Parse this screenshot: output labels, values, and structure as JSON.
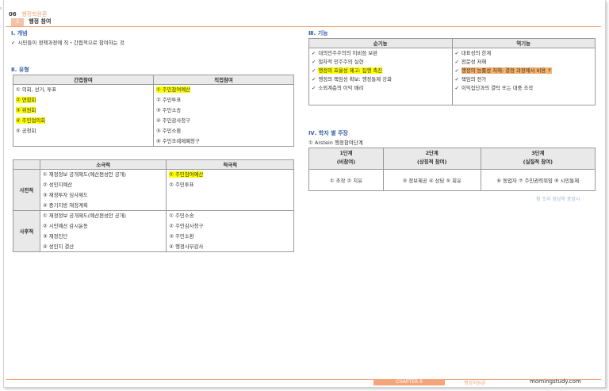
{
  "header": {
    "chapter_num": "06",
    "category": "행정학원론",
    "section_num": "1",
    "section_title": "행정 참여"
  },
  "s1": {
    "heading": "Ⅰ. 개념",
    "text": "시민들이 정책과정에 직・간접적으로 참여하는 것"
  },
  "s2": {
    "heading": "Ⅱ. 유형",
    "table1": {
      "headers": [
        "간접참여",
        "직접참여"
      ],
      "left": [
        "① 의회, 선거, 투표",
        "② 연합회",
        "③ 위원회",
        "④ 주민협의회",
        "⑤ 공청회",
        ""
      ],
      "right": [
        "① 주민참여예산",
        "② 주민투표",
        "③ 주민소송",
        "④ 주민감사청구",
        "⑤ 주민소환",
        "⑥ 주민조례제폐청구"
      ]
    },
    "table2": {
      "headers": [
        "",
        "소극적",
        "적극적"
      ],
      "pre_label": "사전적",
      "pre_left": [
        "① 재정정보 공개제도(예산편성안 공개)",
        "② 성인지예산",
        "③ 재정투자 심사제도",
        "④ 중기지방 재정계획"
      ],
      "pre_right": [
        "① 주민참여예산",
        "② 주민투표",
        "",
        ""
      ],
      "post_label": "사후적",
      "post_left": [
        "① 재정정보 공개제도(예산편성안 공개)",
        "② 시민예산 감시운동",
        "③ 재정진단",
        "④ 성인지 결산"
      ],
      "post_right": [
        "① 주민소송",
        "② 주민감사청구",
        "③ 주민소환",
        "④ 행정사무감사"
      ]
    }
  },
  "s3": {
    "heading": "Ⅲ. 기능",
    "headers": [
      "순기능",
      "역기능"
    ],
    "left": [
      "대의민주주의의 미비점 보완",
      "절차적 민주주의 실현",
      "행정의 효율성 제고: 집행 촉진",
      "행정의 책임성 확보: 행정통제 강화",
      "소외계층의 이익 배려",
      ""
    ],
    "right": [
      "대표성의 한계",
      "전문성 저해",
      "행정의 능률성 저해: 결정 과정에서 비용 ↑",
      "책임의 전가",
      "이익집단과의 결탁 또는 대중 조작",
      ""
    ]
  },
  "s4": {
    "heading": "Ⅳ. 학자 별 주장",
    "sub": "① Arstein 행정참여단계",
    "stages": [
      {
        "title": "1단계",
        "sub": "(비참여)",
        "content": "① 조작   ② 치유"
      },
      {
        "title": "2단계",
        "sub": "(상징적 참여)",
        "content": "③ 정보제공   ④ 상담   ⑤ 회유"
      },
      {
        "title": "3단계",
        "sub": "(실질적 참여)",
        "content": "⑥ 동업자  ⑦ 주민권력위임  ⑧ 시민통제"
      }
    ],
    "source": "참 조지 정상학 중앙시"
  },
  "footer": {
    "chapter": "CHAPTER 6",
    "category": "행정학원론",
    "site": "morningstudy.com"
  },
  "colors": {
    "accent": "#f4a57a",
    "heading": "#3a5fa8",
    "highlight": "#ffff00",
    "highlight_orange": "#f7b26b"
  }
}
